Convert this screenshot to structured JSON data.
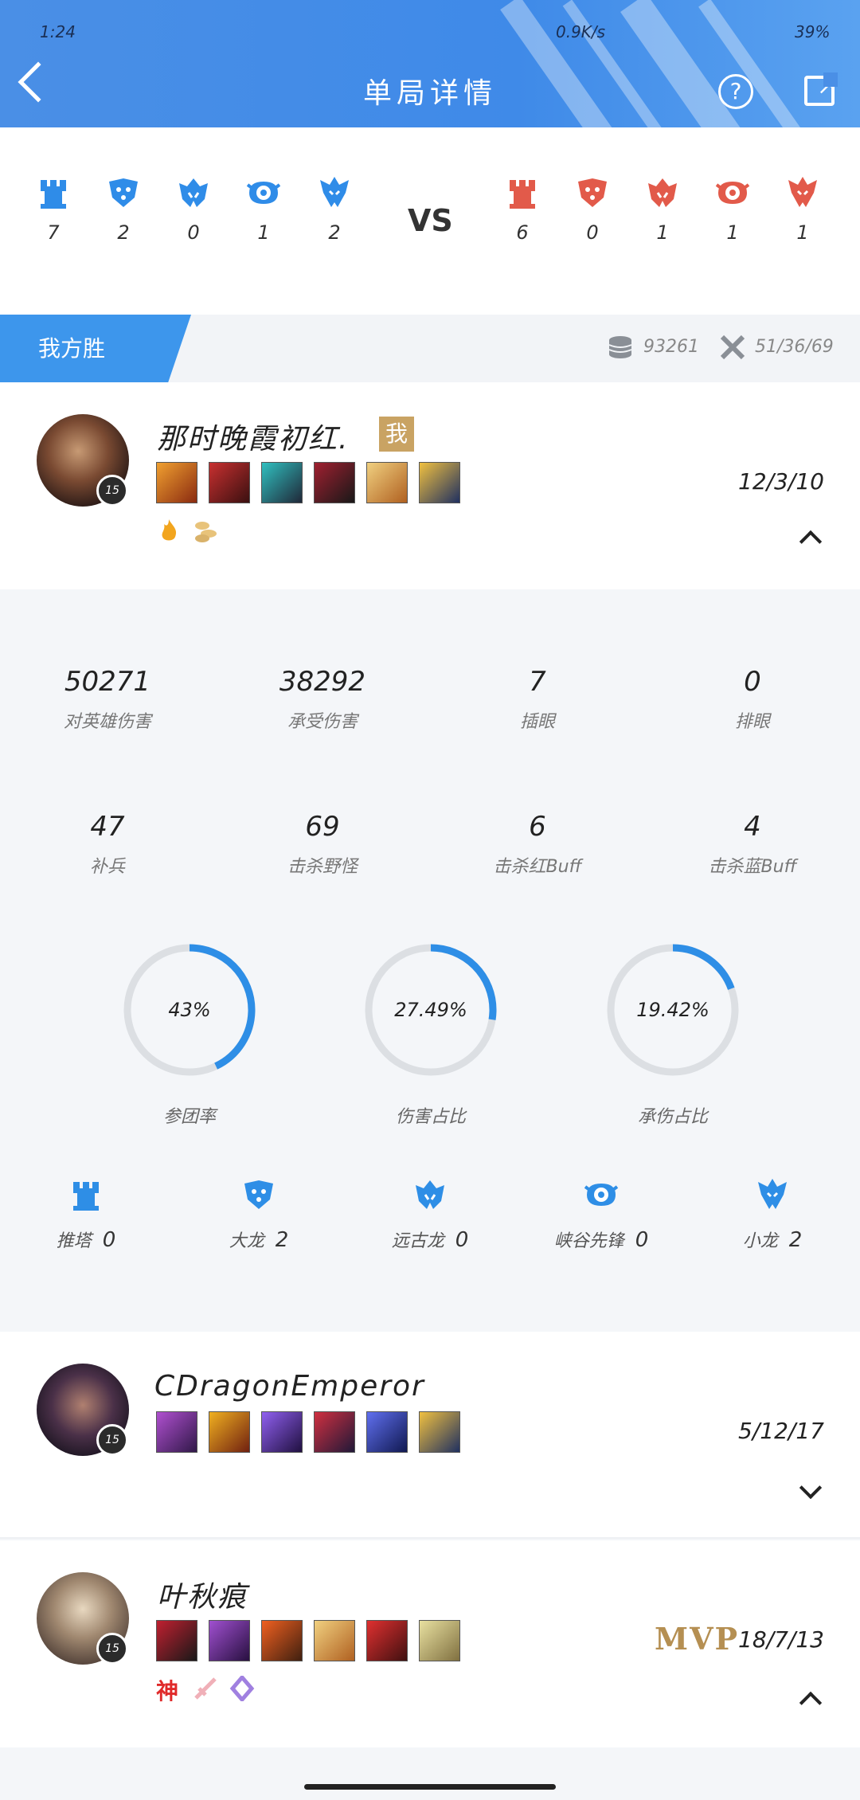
{
  "status_bar": {
    "time": "1:24",
    "network_speed": "0.9K/s",
    "battery": "39%"
  },
  "header": {
    "title": "单局详情",
    "help_label": "?"
  },
  "scoreboard": {
    "vs_label": "VS",
    "blue": [
      {
        "icon": "tower-icon",
        "value": "7"
      },
      {
        "icon": "baron-icon",
        "value": "2"
      },
      {
        "icon": "ancient-dragon-icon",
        "value": "0"
      },
      {
        "icon": "rift-herald-icon",
        "value": "1"
      },
      {
        "icon": "dragon-icon",
        "value": "2"
      }
    ],
    "red": [
      {
        "icon": "tower-icon",
        "value": "6"
      },
      {
        "icon": "baron-icon",
        "value": "0"
      },
      {
        "icon": "ancient-dragon-icon",
        "value": "1"
      },
      {
        "icon": "rift-herald-icon",
        "value": "1"
      },
      {
        "icon": "dragon-icon",
        "value": "1"
      }
    ],
    "colors": {
      "blue": "#2f8ce8",
      "red": "#e25a4a"
    }
  },
  "result": {
    "label": "我方胜",
    "gold": "93261",
    "kda_total": "51/36/69"
  },
  "players": [
    {
      "name": "那时晚霞初红.",
      "level": "15",
      "me_badge": "我",
      "kda": "12/3/10",
      "expanded": true
    },
    {
      "name": "CDragonEmperor",
      "level": "15",
      "kda": "5/12/17",
      "expanded": false
    },
    {
      "name": "叶秋痕",
      "level": "15",
      "kda": "18/7/13",
      "mvp": "MVP",
      "god_badge": "神",
      "expanded": true
    }
  ],
  "details": {
    "stats_row1": [
      {
        "value": "50271",
        "label": "对英雄伤害"
      },
      {
        "value": "38292",
        "label": "承受伤害"
      },
      {
        "value": "7",
        "label": "插眼"
      },
      {
        "value": "0",
        "label": "排眼"
      }
    ],
    "stats_row2": [
      {
        "value": "47",
        "label": "补兵"
      },
      {
        "value": "69",
        "label": "击杀野怪"
      },
      {
        "value": "6",
        "label": "击杀红Buff"
      },
      {
        "value": "4",
        "label": "击杀蓝Buff"
      }
    ],
    "rings": [
      {
        "pct_text": "43%",
        "fraction": 0.43,
        "label": "参团率"
      },
      {
        "pct_text": "27.49%",
        "fraction": 0.2749,
        "label": "伤害占比"
      },
      {
        "pct_text": "19.42%",
        "fraction": 0.1942,
        "label": "承伤占比"
      }
    ],
    "objectives": [
      {
        "icon": "tower-icon",
        "label": "推塔",
        "value": "0"
      },
      {
        "icon": "baron-icon",
        "label": "大龙",
        "value": "2"
      },
      {
        "icon": "ancient-dragon-icon",
        "label": "远古龙",
        "value": "0"
      },
      {
        "icon": "rift-herald-icon",
        "label": "峡谷先锋",
        "value": "0"
      },
      {
        "icon": "dragon-icon",
        "label": "小龙",
        "value": "2"
      }
    ]
  }
}
